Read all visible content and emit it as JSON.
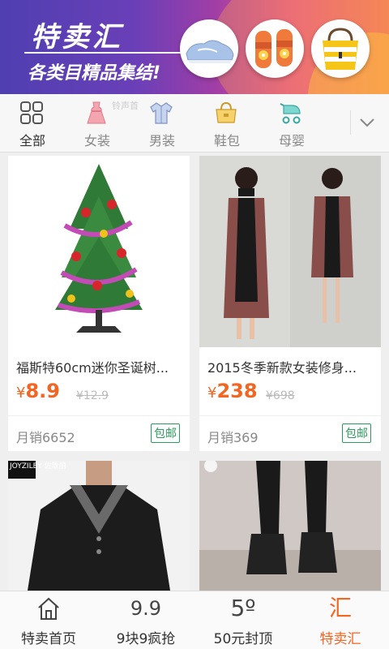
{
  "banner": {
    "title": "特卖汇",
    "subtitle": "各类目精品集结!",
    "products": [
      "sneaker-image",
      "sandal-image",
      "tote-bag-image"
    ]
  },
  "categories": {
    "items": [
      {
        "label": "全部",
        "icon": "grid-icon",
        "active": true
      },
      {
        "label": "女装",
        "icon": "dress-icon",
        "active": false
      },
      {
        "label": "男装",
        "icon": "shirt-icon",
        "active": false
      },
      {
        "label": "鞋包",
        "icon": "handbag-icon",
        "active": false
      },
      {
        "label": "母婴",
        "icon": "stroller-icon",
        "active": false
      }
    ],
    "overlay_hint": "铃声首"
  },
  "products": [
    {
      "title": "福斯特60cm迷你圣诞树...",
      "currency": "¥",
      "price": "8.9",
      "original": "¥12.9",
      "sales": "月销6652",
      "shipping": "包邮"
    },
    {
      "title": "2015冬季新款女装修身...",
      "currency": "¥",
      "price": "238",
      "original": "¥698",
      "sales": "月销369",
      "shipping": "包邮"
    },
    {
      "title": "",
      "brand_tag": "JOYZILEY 佐致丽",
      "currency": "",
      "price": "",
      "original": "",
      "sales": "",
      "shipping": ""
    },
    {
      "title": "",
      "currency": "",
      "price": "",
      "original": "",
      "sales": "",
      "shipping": ""
    }
  ],
  "bottom_nav": {
    "items": [
      {
        "label": "特卖首页",
        "icon": "home-icon",
        "active": false
      },
      {
        "label": "9块9疯抢",
        "icon_text": "9.9",
        "active": false
      },
      {
        "label": "50元封顶",
        "icon_text": "5º",
        "active": false
      },
      {
        "label": "特卖汇",
        "icon_text": "汇",
        "active": true
      }
    ]
  },
  "colors": {
    "accent": "#f26522",
    "shipping_badge": "#2e9b5e",
    "banner_start": "#4f3fb0",
    "banner_end": "#f07a58"
  }
}
